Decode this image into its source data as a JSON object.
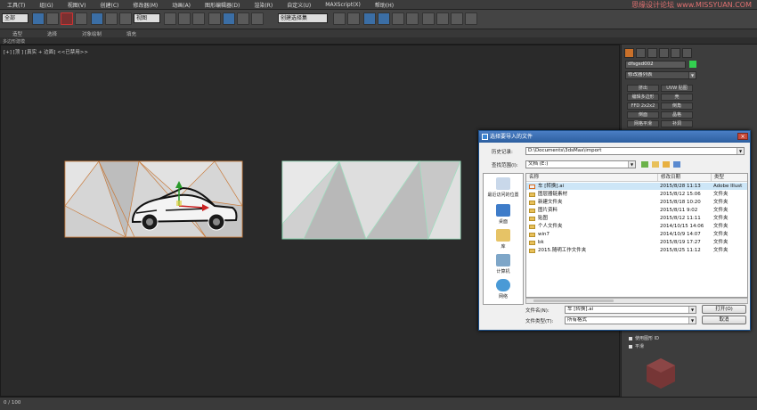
{
  "menu": [
    "工具(T)",
    "组(G)",
    "视图(V)",
    "创建(C)",
    "修改器(M)",
    "动画(A)",
    "图形编辑器(D)",
    "渲染(R)",
    "自定义(U)",
    "MAXScript(X)",
    "帮助(H)"
  ],
  "watermark": "思缘设计论坛 www.MISSYUAN.COM",
  "toolbar": {
    "selection_filter": "全部",
    "view_combo": "视图",
    "named_selection": "创建选择集"
  },
  "ribbon_tabs": [
    "造型",
    "选择",
    "对象绘制",
    "填充"
  ],
  "ribbon_sub": [
    "多边形建模"
  ],
  "viewport": {
    "label": "[+] [顶 ] [真实 + 边面] <<已禁用>>"
  },
  "command_panel": {
    "object_name": "dfsgsd002",
    "modifier_list": "修改器列表",
    "buttons": [
      "挤出",
      "UVW 贴图",
      "编辑多边形",
      "壳",
      "FFD 2x2x2",
      "倒角",
      "倒面",
      "晶格",
      "网格平滑",
      "补洞"
    ],
    "option_label": "使用图形 ID",
    "option_label2": "平滑"
  },
  "timeline": {
    "frame": "0 / 100"
  },
  "dialog": {
    "title": "选择要导入的文件",
    "close": "×",
    "history_label": "历史记录:",
    "history_value": "D:\\Documents\\3dsMax\\import",
    "lookin_label": "查找范围(I):",
    "lookin_value": "文档 (E:)",
    "places": [
      "最近访问的位置",
      "桌面",
      "库",
      "计算机",
      "网络"
    ],
    "columns": [
      "名称",
      "修改日期",
      "类型"
    ],
    "files": [
      {
        "name": "车 [转换].ai",
        "date": "2015/8/28 11:13",
        "type": "Adobe Illust"
      },
      {
        "name": "图层器链素材",
        "date": "2015/8/12 15:06",
        "type": "文件夹"
      },
      {
        "name": "新建文件夹",
        "date": "2015/8/18 10:20",
        "type": "文件夹"
      },
      {
        "name": "图片资料",
        "date": "2015/8/11 9:02",
        "type": "文件夹"
      },
      {
        "name": "贴图",
        "date": "2015/8/12 11:11",
        "type": "文件夹"
      },
      {
        "name": "个人文件夹",
        "date": "2014/10/15 14:06",
        "type": "文件夹"
      },
      {
        "name": "win7",
        "date": "2014/10/9 14:07",
        "type": "文件夹"
      },
      {
        "name": "bk",
        "date": "2015/8/19 17:27",
        "type": "文件夹"
      },
      {
        "name": "2015.随明工作文件夹",
        "date": "2015/8/25 11:12",
        "type": "文件夹"
      }
    ],
    "filename_label": "文件名(N):",
    "filename_value": "车 [转换].ai",
    "filetype_label": "文件类型(T):",
    "filetype_value": "所有格式",
    "open_button": "打开(O)",
    "cancel_button": "取消"
  }
}
